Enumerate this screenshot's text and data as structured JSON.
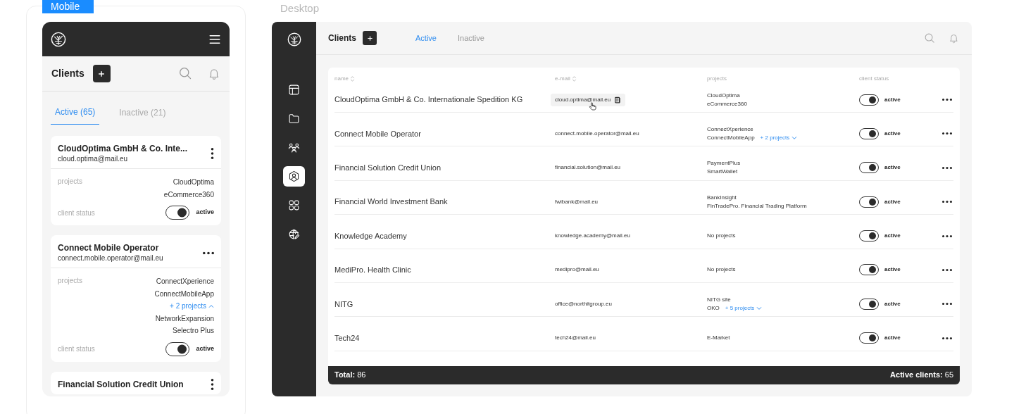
{
  "mobile_label": "Mobile",
  "desktop_label": "Desktop",
  "mobile": {
    "title": "Clients",
    "tabs": [
      {
        "label": "Active (65)",
        "selected": true
      },
      {
        "label": "Inactive (21)",
        "selected": false
      }
    ],
    "cards": [
      {
        "name": "CloudOptima GmbH & Co. Inte...",
        "email": "cloud.optima@mail.eu",
        "kind": "vertical-menu",
        "projects_label": "projects",
        "projects": [
          "CloudOptima",
          "eCommerce360"
        ],
        "status_label": "client status",
        "status": {
          "on": true,
          "text": "active"
        }
      },
      {
        "name": "Connect Mobile Operator",
        "email": "connect.mobile.operator@mail.eu",
        "kind": "horizontal-menu",
        "projects_label": "projects",
        "projects": [
          "ConnectXperience",
          "ConnectMobileApp"
        ],
        "more": {
          "text": "+ 2 projects",
          "expanded": true
        },
        "extra_projects": [
          "NetworkExpansion",
          "Selectro Plus"
        ],
        "status_label": "client status",
        "status": {
          "on": true,
          "text": "active"
        }
      },
      {
        "name": "Financial Solution Credit Union",
        "kind": "vertical-menu"
      }
    ]
  },
  "desktop": {
    "title": "Clients",
    "sidebar": {
      "items": [
        {
          "kind": "layout",
          "selected": false
        },
        {
          "kind": "folder",
          "selected": false
        },
        {
          "kind": "people",
          "selected": false
        },
        {
          "kind": "user",
          "selected": true
        },
        {
          "kind": "grid",
          "selected": false
        },
        {
          "kind": "globe",
          "selected": false
        }
      ]
    },
    "tabs": [
      {
        "label": "Active",
        "selected": true
      },
      {
        "label": "Inactive",
        "selected": false
      }
    ],
    "columns": [
      {
        "label": "name",
        "sortable": true
      },
      {
        "label": "e-mail",
        "sortable": true
      },
      {
        "label": "projects",
        "sortable": false
      },
      {
        "label": "client status",
        "sortable": false
      }
    ],
    "rows": [
      {
        "name": "CloudOptima GmbH & Co. Internationale Spedition KG",
        "email": "cloud.optima@mail.eu",
        "hovered": true,
        "projects": [
          "CloudOptima",
          "eCommerce360"
        ],
        "status": {
          "on": true,
          "text": "active"
        }
      },
      {
        "name": "Connect Mobile Operator",
        "email": "connect.mobile.operator@mail.eu",
        "hovered": false,
        "projects": [
          "ConnectXperience",
          "ConnectMobileApp"
        ],
        "more": {
          "text": "+ 2 projects",
          "expanded": false
        },
        "status": {
          "on": true,
          "text": "active"
        }
      },
      {
        "name": "Financial Solution Credit Union",
        "email": "financial.solution@mail.eu",
        "hovered": false,
        "projects": [
          "PaymentPlus",
          "SmartWallet"
        ],
        "status": {
          "on": true,
          "text": "active"
        }
      },
      {
        "name": "Financial World Investment Bank",
        "email": "fwibank@mail.eu",
        "hovered": false,
        "projects": [
          "BankInsight",
          "FinTradePro. Financial Trading Platform"
        ],
        "status": {
          "on": true,
          "text": "active"
        }
      },
      {
        "name": "Knowledge Academy",
        "email": "knowledge.academy@mail.eu",
        "hovered": false,
        "projects": [
          "No projects"
        ],
        "status": {
          "on": true,
          "text": "active"
        }
      },
      {
        "name": "MediPro. Health Clinic",
        "email": "medipro@mail.eu",
        "hovered": false,
        "projects": [
          "No projects"
        ],
        "status": {
          "on": true,
          "text": "active"
        }
      },
      {
        "name": "NITG",
        "email": "office@northitgroup.eu",
        "hovered": false,
        "projects": [
          "NITG site",
          "OKO"
        ],
        "more": {
          "text": "+ 5 projects",
          "expanded": false
        },
        "status": {
          "on": true,
          "text": "active"
        }
      },
      {
        "name": "Tech24",
        "email": "tech24@mail.eu",
        "hovered": false,
        "projects": [
          "E-Market"
        ],
        "status": {
          "on": true,
          "text": "active"
        }
      }
    ],
    "footer": {
      "total": "**Total:** 86",
      "active": "**Active clients:** 65"
    }
  }
}
